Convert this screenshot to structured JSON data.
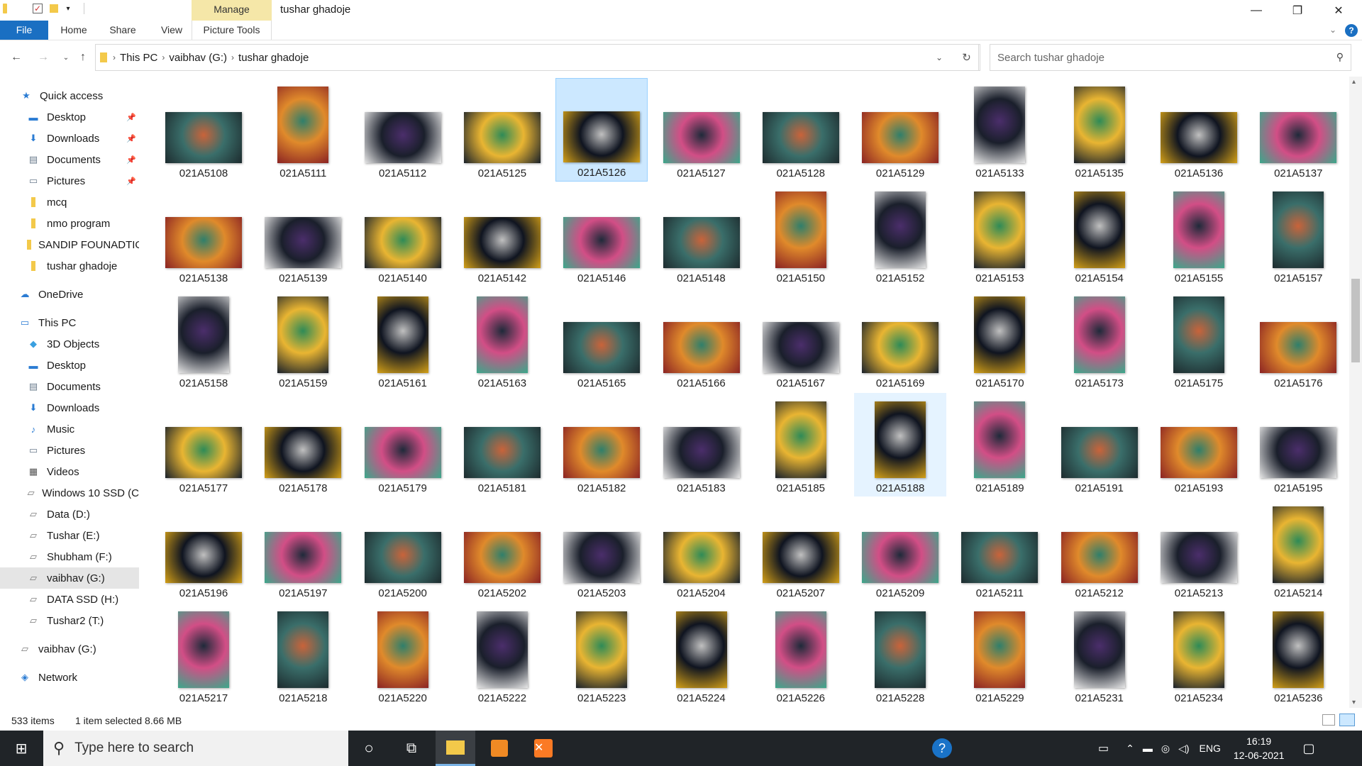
{
  "window": {
    "title": "tushar ghadoje",
    "context_tab": "Manage",
    "controls": {
      "minimize": "—",
      "restore": "❐",
      "close": "✕"
    }
  },
  "ribbon": {
    "tabs": [
      "File",
      "Home",
      "Share",
      "View",
      "Picture Tools"
    ],
    "help": "?"
  },
  "address": {
    "segments": [
      "This PC",
      "vaibhav  (G:)",
      "tushar ghadoje"
    ]
  },
  "search": {
    "placeholder": "Search tushar ghadoje"
  },
  "sidebar": {
    "items": [
      {
        "label": "Quick access",
        "icon": "star-icon",
        "pinned": false
      },
      {
        "label": "Desktop",
        "icon": "desktop-icon",
        "pinned": true
      },
      {
        "label": "Downloads",
        "icon": "download-icon",
        "pinned": true
      },
      {
        "label": "Documents",
        "icon": "documents-icon",
        "pinned": true
      },
      {
        "label": "Pictures",
        "icon": "pictures-icon",
        "pinned": true
      },
      {
        "label": "mcq",
        "icon": "folder-icon",
        "pinned": false
      },
      {
        "label": "nmo program",
        "icon": "folder-icon",
        "pinned": false
      },
      {
        "label": "SANDIP FOUNADTIO",
        "icon": "folder-icon",
        "pinned": false
      },
      {
        "label": "tushar ghadoje",
        "icon": "folder-icon",
        "pinned": false
      },
      {
        "label": "OneDrive",
        "icon": "cloud-icon",
        "pinned": false
      },
      {
        "label": "This PC",
        "icon": "computer-icon",
        "pinned": false
      },
      {
        "label": "3D Objects",
        "icon": "cube-icon",
        "pinned": false
      },
      {
        "label": "Desktop",
        "icon": "desktop-icon",
        "pinned": false
      },
      {
        "label": "Documents",
        "icon": "documents-icon",
        "pinned": false
      },
      {
        "label": "Downloads",
        "icon": "download-icon",
        "pinned": false
      },
      {
        "label": "Music",
        "icon": "music-icon",
        "pinned": false
      },
      {
        "label": "Pictures",
        "icon": "pictures-icon",
        "pinned": false
      },
      {
        "label": "Videos",
        "icon": "videos-icon",
        "pinned": false
      },
      {
        "label": "Windows 10 SSD (C",
        "icon": "drive-icon",
        "pinned": false
      },
      {
        "label": "Data (D:)",
        "icon": "drive-icon",
        "pinned": false
      },
      {
        "label": "Tushar (E:)",
        "icon": "drive-icon",
        "pinned": false
      },
      {
        "label": "Shubham (F:)",
        "icon": "drive-icon",
        "pinned": false
      },
      {
        "label": "vaibhav  (G:)",
        "icon": "drive-icon",
        "pinned": false,
        "selected": true
      },
      {
        "label": "DATA SSD (H:)",
        "icon": "drive-icon",
        "pinned": false
      },
      {
        "label": "Tushar2 (T:)",
        "icon": "drive-icon",
        "pinned": false
      },
      {
        "label": "vaibhav  (G:)",
        "icon": "drive-icon",
        "pinned": false
      },
      {
        "label": "Network",
        "icon": "network-icon",
        "pinned": false
      }
    ]
  },
  "files": [
    [
      "021A5108",
      "021A5111",
      "021A5112",
      "021A5125",
      "021A5126",
      "021A5127",
      "021A5128",
      "021A5129",
      "021A5133",
      "021A5135",
      "021A5136",
      "021A5137"
    ],
    [
      "021A5138",
      "021A5139",
      "021A5140",
      "021A5142",
      "021A5146",
      "021A5148",
      "021A5150",
      "021A5152",
      "021A5153",
      "021A5154",
      "021A5155",
      "021A5157"
    ],
    [
      "021A5158",
      "021A5159",
      "021A5161",
      "021A5163",
      "021A5165",
      "021A5166",
      "021A5167",
      "021A5169",
      "021A5170",
      "021A5173",
      "021A5175",
      "021A5176"
    ],
    [
      "021A5177",
      "021A5178",
      "021A5179",
      "021A5181",
      "021A5182",
      "021A5183",
      "021A5185",
      "021A5188",
      "021A5189",
      "021A5191",
      "021A5193",
      "021A5195"
    ],
    [
      "021A5196",
      "021A5197",
      "021A5200",
      "021A5202",
      "021A5203",
      "021A5204",
      "021A5207",
      "021A5209",
      "021A5211",
      "021A5212",
      "021A5213",
      "021A5214"
    ],
    [
      "021A5217",
      "021A5218",
      "021A5220",
      "021A5222",
      "021A5223",
      "021A5224",
      "021A5226",
      "021A5228",
      "021A5229",
      "021A5231",
      "021A5234",
      "021A5236"
    ]
  ],
  "orientation": [
    "LPLLLLLLPPLL",
    "LLLLLLPPPPPP",
    "PPPPLLLLPPPL",
    "LLLLLLPPPLLL",
    "LLLLLLLLLLLP",
    "PPPPPPPPPPPP"
  ],
  "selected_file": "021A5126",
  "hovered_file": "021A5188",
  "status": {
    "count": "533 items",
    "selection": "1 item selected  8.66 MB"
  },
  "taskbar": {
    "search_placeholder": "Type here to search",
    "language": "ENG",
    "time": "16:19",
    "date": "12-06-2021"
  }
}
